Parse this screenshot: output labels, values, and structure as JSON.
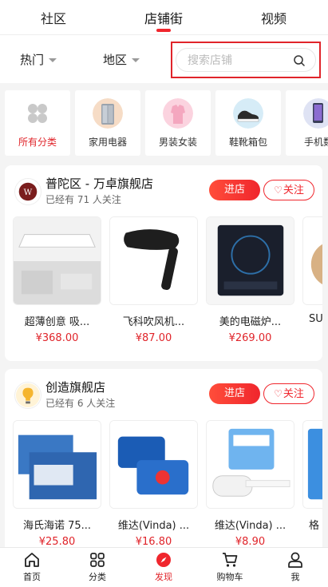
{
  "top_tabs": [
    {
      "label": "社区"
    },
    {
      "label": "店铺街"
    },
    {
      "label": "视频"
    }
  ],
  "filters": {
    "hot": "热门",
    "region": "地区"
  },
  "search": {
    "placeholder": "搜索店铺"
  },
  "categories": [
    {
      "label": "所有分类",
      "icon": "grid-icon"
    },
    {
      "label": "家用电器",
      "icon": "fridge-icon"
    },
    {
      "label": "男装女装",
      "icon": "shirt-icon"
    },
    {
      "label": "鞋靴箱包",
      "icon": "sneaker-icon"
    },
    {
      "label": "手机数",
      "icon": "phone-icon"
    }
  ],
  "shops": [
    {
      "name": "普陀区 - 万卓旗舰店",
      "followers": "已经有 71 人关注",
      "enter_label": "进店",
      "follow_label": "关注",
      "products": [
        {
          "name": "超薄创意 吸...",
          "price": "¥368.00"
        },
        {
          "name": "飞科吹风机...",
          "price": "¥87.00"
        },
        {
          "name": "美的电磁炉...",
          "price": "¥269.00"
        },
        {
          "name": "SU",
          "price": ""
        }
      ]
    },
    {
      "name": "创造旗舰店",
      "followers": "已经有 6 人关注",
      "enter_label": "进店",
      "follow_label": "关注",
      "products": [
        {
          "name": "海氏海诺 75...",
          "price": "¥25.80"
        },
        {
          "name": "维达(Vinda) ...",
          "price": "¥16.80"
        },
        {
          "name": "维达(Vinda) ...",
          "price": "¥8.90"
        },
        {
          "name": "格",
          "price": ""
        }
      ]
    }
  ],
  "bottom_nav": [
    {
      "label": "首页",
      "icon": "home-icon"
    },
    {
      "label": "分类",
      "icon": "category-icon"
    },
    {
      "label": "发现",
      "icon": "compass-icon"
    },
    {
      "label": "购物车",
      "icon": "cart-icon"
    },
    {
      "label": "我",
      "icon": "user-icon"
    }
  ],
  "colors": {
    "accent": "#f0262d",
    "highlight_border": "#e0242a"
  }
}
